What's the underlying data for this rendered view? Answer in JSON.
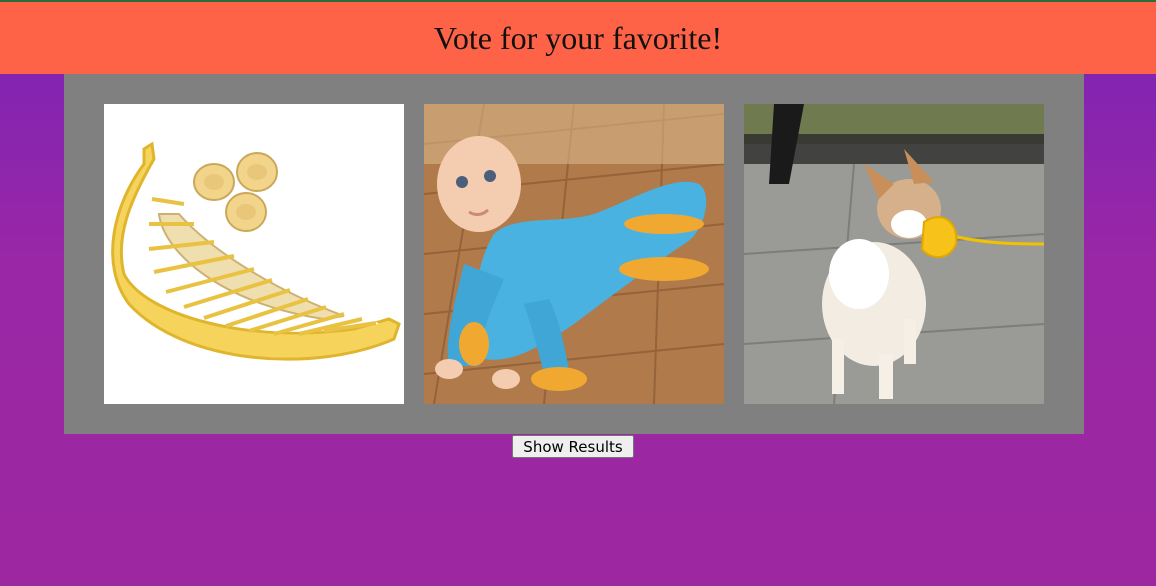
{
  "header": {
    "title": "Vote for your favorite!"
  },
  "choices": [
    {
      "icon": "banana-slicer-image"
    },
    {
      "icon": "baby-mop-image"
    },
    {
      "icon": "dog-duck-muzzle-image"
    }
  ],
  "actions": {
    "show_results_label": "Show Results"
  },
  "colors": {
    "header_bg": "#ff6347",
    "panel_bg": "#808080",
    "page_bg": "#9a27a6"
  }
}
